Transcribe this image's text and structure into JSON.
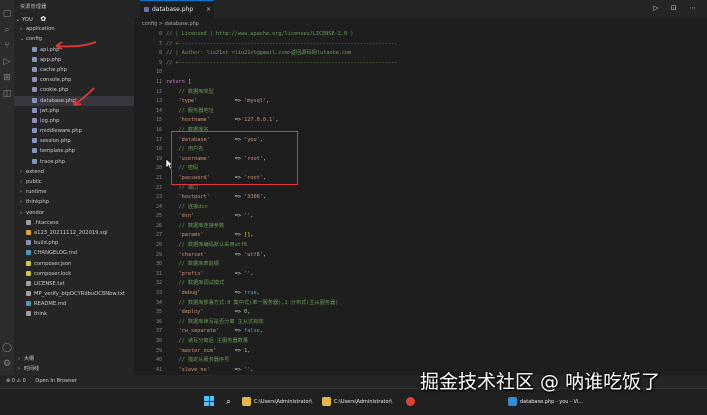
{
  "activity_bar": {
    "icons": [
      "files-icon",
      "search-icon",
      "source-control-icon",
      "run-debug-icon",
      "extensions-icon",
      "remote-icon",
      "settings-icon",
      "account-icon"
    ]
  },
  "sidebar": {
    "title": "资源管理器",
    "root": "YOU",
    "items": [
      {
        "label": "application",
        "kind": "folder",
        "indent": 1,
        "open": false
      },
      {
        "label": "config",
        "kind": "folder",
        "indent": 1,
        "open": true
      },
      {
        "label": "api.php",
        "kind": "php",
        "indent": 2
      },
      {
        "label": "app.php",
        "kind": "php",
        "indent": 2
      },
      {
        "label": "cache.php",
        "kind": "php",
        "indent": 2
      },
      {
        "label": "console.php",
        "kind": "php",
        "indent": 2
      },
      {
        "label": "cookie.php",
        "kind": "php",
        "indent": 2
      },
      {
        "label": "database.php",
        "kind": "php",
        "indent": 2,
        "selected": true
      },
      {
        "label": "jwt.php",
        "kind": "php",
        "indent": 2
      },
      {
        "label": "log.php",
        "kind": "php",
        "indent": 2
      },
      {
        "label": "middleware.php",
        "kind": "php",
        "indent": 2
      },
      {
        "label": "session.php",
        "kind": "php",
        "indent": 2
      },
      {
        "label": "template.php",
        "kind": "php",
        "indent": 2
      },
      {
        "label": "trace.php",
        "kind": "php",
        "indent": 2
      },
      {
        "label": "extend",
        "kind": "folder",
        "indent": 1,
        "open": false
      },
      {
        "label": "public",
        "kind": "folder",
        "indent": 1,
        "open": false
      },
      {
        "label": "runtime",
        "kind": "folder",
        "indent": 1,
        "open": false
      },
      {
        "label": "thinkphp",
        "kind": "folder",
        "indent": 1,
        "open": false
      },
      {
        "label": "vendor",
        "kind": "folder",
        "indent": 1,
        "open": false
      },
      {
        "label": ".htaccess",
        "kind": "file",
        "indent": 1
      },
      {
        "label": "a123_20211112_202019.sql",
        "kind": "sql",
        "indent": 1
      },
      {
        "label": "build.php",
        "kind": "php",
        "indent": 1
      },
      {
        "label": "CHANGELOG.md",
        "kind": "md",
        "indent": 1
      },
      {
        "label": "composer.json",
        "kind": "json",
        "indent": 1
      },
      {
        "label": "composer.lock",
        "kind": "json",
        "indent": 1
      },
      {
        "label": "LICENSE.txt",
        "kind": "txt",
        "indent": 1
      },
      {
        "label": "MP_verify_btpDCYRdbuOC8Nbw.txt",
        "kind": "txt",
        "indent": 1
      },
      {
        "label": "README.md",
        "kind": "md",
        "indent": 1
      },
      {
        "label": "think",
        "kind": "file",
        "indent": 1
      }
    ],
    "bottom": [
      {
        "label": "大纲"
      },
      {
        "label": "时间线"
      }
    ]
  },
  "editor": {
    "tab_label": "database.php",
    "tab_close": "×",
    "actions": "▷ ⊡ ⋯",
    "breadcrumb": "config > database.php",
    "first_line": 6,
    "lines": [
      [
        [
          "// | Licensed ( http://www.apache.org/licenses/LICENSE-2.0 )",
          "com"
        ]
      ],
      [
        [
          "// +----------------------------------------------------------------------",
          "com"
        ]
      ],
      [
        [
          "// | Author: liu21st <liu21st@gmail.com>返回源码网lutaobe.com",
          "com"
        ]
      ],
      [
        [
          "// +----------------------------------------------------------------------",
          "com"
        ]
      ],
      [
        [
          "",
          ""
        ]
      ],
      [
        [
          "return ",
          "kw"
        ],
        [
          "[",
          "br"
        ]
      ],
      [
        [
          "    // 数据库类型",
          "com"
        ]
      ],
      [
        [
          "    ",
          "op"
        ],
        [
          "'type'",
          "str"
        ],
        [
          "            => ",
          "op"
        ],
        [
          "'mysql'",
          "str"
        ],
        [
          ",",
          "op"
        ]
      ],
      [
        [
          "    // 服务器地址",
          "com"
        ]
      ],
      [
        [
          "    ",
          "op"
        ],
        [
          "'hostname'",
          "str"
        ],
        [
          "        =>",
          "op"
        ],
        [
          "'127.0.0.1'",
          "str"
        ],
        [
          ",",
          "op"
        ]
      ],
      [
        [
          "    // 数据库名",
          "com"
        ]
      ],
      [
        [
          "    ",
          "op"
        ],
        [
          "'database'",
          "str"
        ],
        [
          "        => ",
          "op"
        ],
        [
          "'you'",
          "str"
        ],
        [
          ",",
          "op"
        ]
      ],
      [
        [
          "    // 用户名",
          "com"
        ]
      ],
      [
        [
          "    ",
          "op"
        ],
        [
          "'username'",
          "str"
        ],
        [
          "        => ",
          "op"
        ],
        [
          "'root'",
          "str"
        ],
        [
          ",",
          "op"
        ]
      ],
      [
        [
          "    // 密码",
          "com"
        ]
      ],
      [
        [
          "    ",
          "op"
        ],
        [
          "'password'",
          "str"
        ],
        [
          "        => ",
          "op"
        ],
        [
          "'root'",
          "str"
        ],
        [
          ",",
          "op"
        ]
      ],
      [
        [
          "    // 端口",
          "com"
        ]
      ],
      [
        [
          "    ",
          "op"
        ],
        [
          "'hostport'",
          "str"
        ],
        [
          "        => ",
          "op"
        ],
        [
          "'3306'",
          "str"
        ],
        [
          ",",
          "op"
        ]
      ],
      [
        [
          "    // 连接dsn",
          "com"
        ]
      ],
      [
        [
          "    ",
          "op"
        ],
        [
          "'dsn'",
          "str"
        ],
        [
          "             => ",
          "op"
        ],
        [
          "''",
          "str"
        ],
        [
          ",",
          "op"
        ]
      ],
      [
        [
          "    // 数据库连接参数",
          "com"
        ]
      ],
      [
        [
          "    ",
          "op"
        ],
        [
          "'params'",
          "str"
        ],
        [
          "          => ",
          "op"
        ],
        [
          "[]",
          "br"
        ],
        [
          ",",
          "op"
        ]
      ],
      [
        [
          "    // 数据库编码默认采用utf8",
          "com"
        ]
      ],
      [
        [
          "    ",
          "op"
        ],
        [
          "'charset'",
          "str"
        ],
        [
          "         => ",
          "op"
        ],
        [
          "'utf8'",
          "str"
        ],
        [
          ",",
          "op"
        ]
      ],
      [
        [
          "    // 数据库表前缀",
          "com"
        ]
      ],
      [
        [
          "    ",
          "op"
        ],
        [
          "'prefix'",
          "str"
        ],
        [
          "          => ",
          "op"
        ],
        [
          "''",
          "str"
        ],
        [
          ",",
          "op"
        ]
      ],
      [
        [
          "    // 数据库调试模式",
          "com"
        ]
      ],
      [
        [
          "    ",
          "op"
        ],
        [
          "'debug'",
          "str"
        ],
        [
          "           => ",
          "op"
        ],
        [
          "true",
          "bool"
        ],
        [
          ",",
          "op"
        ]
      ],
      [
        [
          "    // 数据库部署方式:0 集中式(单一服务器),1 分布式(主从服务器)",
          "com"
        ]
      ],
      [
        [
          "    ",
          "op"
        ],
        [
          "'deploy'",
          "str"
        ],
        [
          "          => ",
          "op"
        ],
        [
          "0",
          "num"
        ],
        [
          ",",
          "op"
        ]
      ],
      [
        [
          "    // 数据库读写是否分离 主从式有效",
          "com"
        ]
      ],
      [
        [
          "    ",
          "op"
        ],
        [
          "'rw_separate'",
          "str"
        ],
        [
          "     => ",
          "op"
        ],
        [
          "false",
          "bool"
        ],
        [
          ",",
          "op"
        ]
      ],
      [
        [
          "    // 读写分离后 主服务器数量",
          "com"
        ]
      ],
      [
        [
          "    ",
          "op"
        ],
        [
          "'master_num'",
          "str"
        ],
        [
          "      => ",
          "op"
        ],
        [
          "1",
          "num"
        ],
        [
          ",",
          "op"
        ]
      ],
      [
        [
          "    // 指定从服务器序号",
          "com"
        ]
      ],
      [
        [
          "    ",
          "op"
        ],
        [
          "'slave_no'",
          "str"
        ],
        [
          "        => ",
          "op"
        ],
        [
          "''",
          "str"
        ],
        [
          ",",
          "op"
        ]
      ],
      [
        [
          "    // 自动读取主库数据",
          "com"
        ]
      ],
      [
        [
          "    ",
          "op"
        ],
        [
          "'read_master'",
          "str"
        ],
        [
          "     => ",
          "op"
        ],
        [
          "false",
          "bool"
        ],
        [
          ",",
          "op"
        ]
      ],
      [
        [
          "    // 是否严格检查字段是否存在",
          "com"
        ]
      ]
    ]
  },
  "status_bar": {
    "errors": "⊗ 0 ⚠ 0",
    "live": "Open In Browser"
  },
  "taskbar": {
    "items": [
      {
        "label": "C:\\Users\\Administrator\\",
        "color": "#e8b64a"
      },
      {
        "label": "C:\\Users\\Administrator\\",
        "color": "#e8b64a"
      },
      {
        "label": "database.php - you - Vi...",
        "color": "#2f8fd8"
      }
    ]
  },
  "watermark": "掘金技术社区 @ 呐谁吃饭了",
  "colors": {
    "annotation_red": "#e0383a",
    "accent": "#007acc"
  }
}
